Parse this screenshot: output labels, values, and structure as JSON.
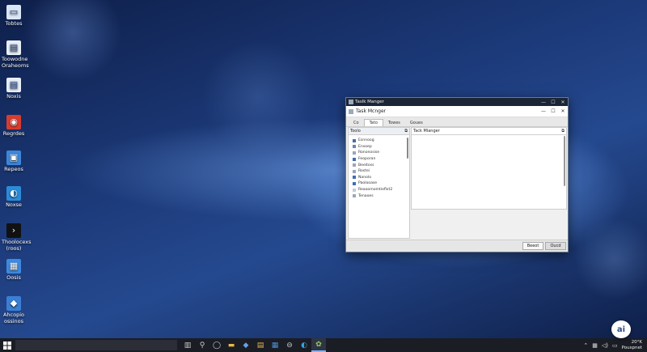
{
  "desktop": {
    "icons": [
      {
        "label": "Tobtes",
        "icon": "computer-icon",
        "color": "#dbe6f5"
      },
      {
        "label": "Toowodne Oraheoms",
        "icon": "document-icon",
        "color": "#e8eef5"
      },
      {
        "label": "Noxis",
        "icon": "document-icon",
        "color": "#e8eef5"
      },
      {
        "label": "Regrdes",
        "icon": "media-icon",
        "color": "#d93b2f"
      },
      {
        "label": "Repeos",
        "icon": "monitor-icon",
        "color": "#3d87d8"
      },
      {
        "label": "Noxse",
        "icon": "edge-icon",
        "color": "#2a8cd8"
      },
      {
        "label": "Thoolocexs (roos)",
        "icon": "terminal-icon",
        "color": "#111111"
      },
      {
        "label": "Oosis",
        "icon": "files-icon",
        "color": "#3d8ae0"
      },
      {
        "label": "Ahcopio ossinos",
        "icon": "store-icon",
        "color": "#3b7fd4"
      }
    ]
  },
  "window": {
    "outer_title": "Taslk Manger",
    "inner_title": "Task Mcnger",
    "controls": {
      "minimize": "—",
      "maximize": "☐",
      "close": "✕"
    },
    "tabs": [
      "Co",
      "Tato",
      "Towes",
      "Goues"
    ],
    "active_tab_index": 1,
    "left_pane": {
      "header": "Toolo",
      "items": [
        {
          "label": "Esnnoog",
          "color": "#3f6fb0"
        },
        {
          "label": "Ensoep",
          "color": "#6a86b0"
        },
        {
          "label": "Rononosise",
          "color": "#9aa7b8"
        },
        {
          "label": "Feoporan",
          "color": "#3f6fb0"
        },
        {
          "label": "Beeitoss",
          "color": "#9aa7b8"
        },
        {
          "label": "Rostei",
          "color": "#9aa7b8"
        },
        {
          "label": "Nanolo",
          "color": "#3f6fb0"
        },
        {
          "label": "Paolooase",
          "color": "#3f6fb0"
        },
        {
          "label": "Reaoomomtieflxt2",
          "color": "#c5ccd6"
        },
        {
          "label": "Tenaoes",
          "color": "#9aa7b8"
        }
      ]
    },
    "right_pane": {
      "header": "Tack Mlanger"
    },
    "buttons": {
      "primary": "Beeot",
      "secondary": "Oucd"
    }
  },
  "taskbar": {
    "apps": [
      "task-view-icon",
      "search-icon",
      "chat-icon",
      "folder-icon",
      "store-icon",
      "explorer-icon",
      "files-icon",
      "media-icon",
      "edge-icon",
      "settings-icon"
    ],
    "active_app_index": 9,
    "clock_time": "20°K",
    "clock_date": "Pouspnet",
    "badge": "ai"
  }
}
